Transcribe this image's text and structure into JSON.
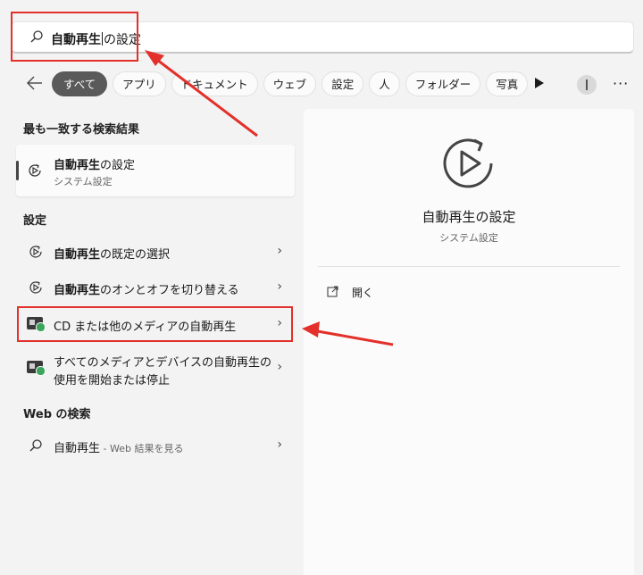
{
  "search": {
    "query_bold": "自動再生",
    "query_rest": "の設定"
  },
  "filters": [
    {
      "label": "すべて",
      "active": true
    },
    {
      "label": "アプリ",
      "active": false
    },
    {
      "label": "ドキュメント",
      "active": false
    },
    {
      "label": "ウェブ",
      "active": false
    },
    {
      "label": "設定",
      "active": false
    },
    {
      "label": "人",
      "active": false
    },
    {
      "label": "フォルダー",
      "active": false
    },
    {
      "label": "写真",
      "active": false
    }
  ],
  "best_match": {
    "heading": "最も一致する検索結果",
    "title_bold": "自動再生",
    "title_rest": "の設定",
    "subtitle": "システム設定"
  },
  "settings": {
    "heading": "設定",
    "items": [
      {
        "bold": "自動再生",
        "rest": "の既定の選択",
        "icon": "autoplay-icon"
      },
      {
        "bold": "自動再生",
        "rest": "のオンとオフを切り替える",
        "icon": "autoplay-icon"
      },
      {
        "bold": "",
        "rest": "CD または他のメディアの自動再生",
        "icon": "media-autoplay-icon"
      },
      {
        "line1": "すべてのメディアとデバイスの自動再生の",
        "line2": "使用を開始または停止",
        "icon": "media-autoplay-icon"
      }
    ]
  },
  "web": {
    "heading": "Web の検索",
    "query": "自動再生",
    "suffix": " - Web 結果を見る"
  },
  "preview": {
    "title": "自動再生の設定",
    "subtitle": "システム設定",
    "open_label": "開く"
  },
  "colors": {
    "annotation": "#e3302a",
    "accent_chip": "#5a5a5a"
  }
}
